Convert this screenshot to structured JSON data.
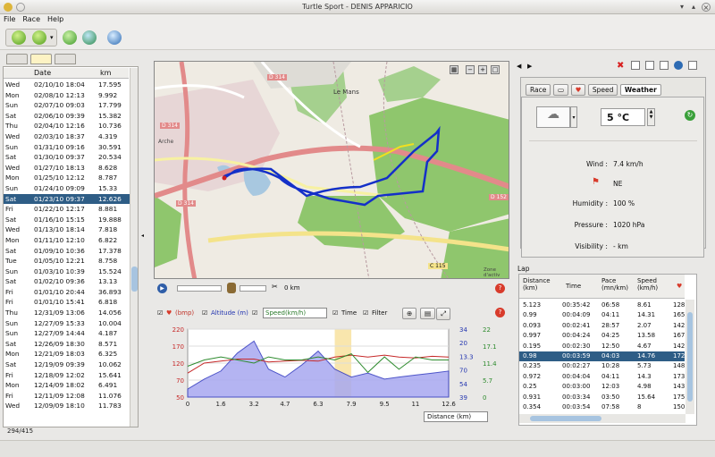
{
  "window": {
    "title": "Turtle Sport - DENIS APPARICIO"
  },
  "menu": [
    "File",
    "Race",
    "Help"
  ],
  "activities": {
    "headers": {
      "date": "Date",
      "km": "km"
    },
    "rows": [
      {
        "day": "Wed",
        "date": "02/10/10 18:04",
        "km": "17.595"
      },
      {
        "day": "Mon",
        "date": "02/08/10 12:13",
        "km": "9.992"
      },
      {
        "day": "Sun",
        "date": "02/07/10 09:03",
        "km": "17.799"
      },
      {
        "day": "Sat",
        "date": "02/06/10 09:39",
        "km": "15.382"
      },
      {
        "day": "Thu",
        "date": "02/04/10 12:16",
        "km": "10.736"
      },
      {
        "day": "Wed",
        "date": "02/03/10 18:37",
        "km": "4.319"
      },
      {
        "day": "Sun",
        "date": "01/31/10 09:16",
        "km": "30.591"
      },
      {
        "day": "Sat",
        "date": "01/30/10 09:37",
        "km": "20.534"
      },
      {
        "day": "Wed",
        "date": "01/27/10 18:13",
        "km": "8.628"
      },
      {
        "day": "Mon",
        "date": "01/25/10 12:12",
        "km": "8.787"
      },
      {
        "day": "Sun",
        "date": "01/24/10 09:09",
        "km": "15.33"
      },
      {
        "day": "Sat",
        "date": "01/23/10 09:37",
        "km": "12.626"
      },
      {
        "day": "Fri",
        "date": "01/22/10 12:17",
        "km": "8.881"
      },
      {
        "day": "Sat",
        "date": "01/16/10 15:15",
        "km": "19.888"
      },
      {
        "day": "Wed",
        "date": "01/13/10 18:14",
        "km": "7.818"
      },
      {
        "day": "Mon",
        "date": "01/11/10 12:10",
        "km": "6.822"
      },
      {
        "day": "Sat",
        "date": "01/09/10 10:36",
        "km": "17.378"
      },
      {
        "day": "Tue",
        "date": "01/05/10 12:21",
        "km": "8.758"
      },
      {
        "day": "Sun",
        "date": "01/03/10 10:39",
        "km": "15.524"
      },
      {
        "day": "Sat",
        "date": "01/02/10 09:36",
        "km": "13.13"
      },
      {
        "day": "Fri",
        "date": "01/01/10 20:44",
        "km": "36.893"
      },
      {
        "day": "Fri",
        "date": "01/01/10 15:41",
        "km": "6.818"
      },
      {
        "day": "Thu",
        "date": "12/31/09 13:06",
        "km": "14.056"
      },
      {
        "day": "Sun",
        "date": "12/27/09 15:33",
        "km": "10.004"
      },
      {
        "day": "Sun",
        "date": "12/27/09 14:44",
        "km": "4.187"
      },
      {
        "day": "Sat",
        "date": "12/26/09 18:30",
        "km": "8.571"
      },
      {
        "day": "Mon",
        "date": "12/21/09 18:03",
        "km": "6.325"
      },
      {
        "day": "Sat",
        "date": "12/19/09 09:39",
        "km": "10.062"
      },
      {
        "day": "Fri",
        "date": "12/18/09 12:02",
        "km": "15.641"
      },
      {
        "day": "Mon",
        "date": "12/14/09 18:02",
        "km": "6.491"
      },
      {
        "day": "Fri",
        "date": "12/11/09 12:08",
        "km": "11.076"
      },
      {
        "day": "Wed",
        "date": "12/09/09 18:10",
        "km": "11.783"
      }
    ],
    "selected_index": 11
  },
  "status": {
    "count": "294/415"
  },
  "map": {
    "labels": {
      "d314a": "D 314",
      "d314b": "D 314",
      "d314c": "D 314",
      "lemans": "Le Mans",
      "d152": "D 152",
      "c115": "C 115",
      "arche": "Arche",
      "zone": "Zone d'activ"
    },
    "distance_label": "0 km"
  },
  "chart": {
    "options": {
      "hr": "(bmp)",
      "alt": "Altitude (m)",
      "speed": "Speed(km/h)",
      "time": "Time",
      "filter": "Filter"
    },
    "left_axis": [
      "220",
      "170",
      "120",
      "70",
      "50"
    ],
    "right_axis1": [
      "34",
      "20",
      "13.3",
      "70",
      "54",
      "39"
    ],
    "right_axis2": [
      "22",
      "17.1",
      "11.4",
      "5.7",
      "0"
    ],
    "x_ticks": [
      "0",
      "1.6",
      "3.2",
      "4.7",
      "6.3",
      "7.9",
      "9.5",
      "11",
      "12.6"
    ],
    "xaxis_select": "Distance (km)"
  },
  "chart_data": {
    "type": "line",
    "x": [
      0,
      0.8,
      1.6,
      2.4,
      3.2,
      3.9,
      4.7,
      5.5,
      6.3,
      7.1,
      7.9,
      8.7,
      9.5,
      10.2,
      11,
      11.8,
      12.6
    ],
    "series": [
      {
        "name": "(bmp)",
        "values": [
          110,
          135,
          140,
          145,
          145,
          138,
          140,
          142,
          140,
          150,
          155,
          150,
          155,
          150,
          148,
          152,
          150
        ]
      },
      {
        "name": "Altitude (m)",
        "values": [
          70,
          95,
          115,
          160,
          190,
          120,
          100,
          130,
          165,
          120,
          100,
          110,
          95,
          100,
          105,
          110,
          115
        ]
      },
      {
        "name": "Speed(km/h)",
        "values": [
          10,
          12,
          13,
          12,
          11,
          13,
          12,
          12,
          13,
          12,
          14,
          8,
          13,
          9,
          13,
          12,
          12
        ]
      }
    ],
    "xlabel": "Distance (km)",
    "ylim": [
      50,
      220
    ]
  },
  "right_tabs": [
    "Race",
    "Speed",
    "Weather"
  ],
  "weather": {
    "temperature": "5 °C",
    "wind_label": "Wind :",
    "wind": "7.4 km/h",
    "direction": "NE",
    "humidity_label": "Humidity :",
    "humidity": "100 %",
    "pressure_label": "Pressure :",
    "pressure": "1020 hPa",
    "visibility_label": "Visibility :",
    "visibility": "- km"
  },
  "lap": {
    "title": "Lap",
    "headers": [
      {
        "l1": "Distance",
        "l2": "(km)"
      },
      {
        "l1": "Time",
        "l2": ""
      },
      {
        "l1": "Pace",
        "l2": "(mn/km)"
      },
      {
        "l1": "Speed",
        "l2": "(km/h)"
      }
    ],
    "rows": [
      {
        "d": "5.123",
        "t": "00:35:42",
        "p": "06:58",
        "s": "8.61",
        "h": "128"
      },
      {
        "d": "0.99",
        "t": "00:04:09",
        "p": "04:11",
        "s": "14.31",
        "h": "165"
      },
      {
        "d": "0.093",
        "t": "00:02:41",
        "p": "28:57",
        "s": "2.07",
        "h": "142"
      },
      {
        "d": "0.997",
        "t": "00:04:24",
        "p": "04:25",
        "s": "13.58",
        "h": "167"
      },
      {
        "d": "0.195",
        "t": "00:02:30",
        "p": "12:50",
        "s": "4.67",
        "h": "142"
      },
      {
        "d": "0.98",
        "t": "00:03:59",
        "p": "04:03",
        "s": "14.76",
        "h": "172"
      },
      {
        "d": "0.235",
        "t": "00:02:27",
        "p": "10:28",
        "s": "5.73",
        "h": "148"
      },
      {
        "d": "0.972",
        "t": "00:04:04",
        "p": "04:11",
        "s": "14.3",
        "h": "173"
      },
      {
        "d": "0.25",
        "t": "00:03:00",
        "p": "12:03",
        "s": "4.98",
        "h": "143"
      },
      {
        "d": "0.931",
        "t": "00:03:34",
        "p": "03:50",
        "s": "15.64",
        "h": "175"
      },
      {
        "d": "0.354",
        "t": "00:03:54",
        "p": "07:58",
        "s": "8",
        "h": "150"
      }
    ],
    "selected_index": 5
  }
}
